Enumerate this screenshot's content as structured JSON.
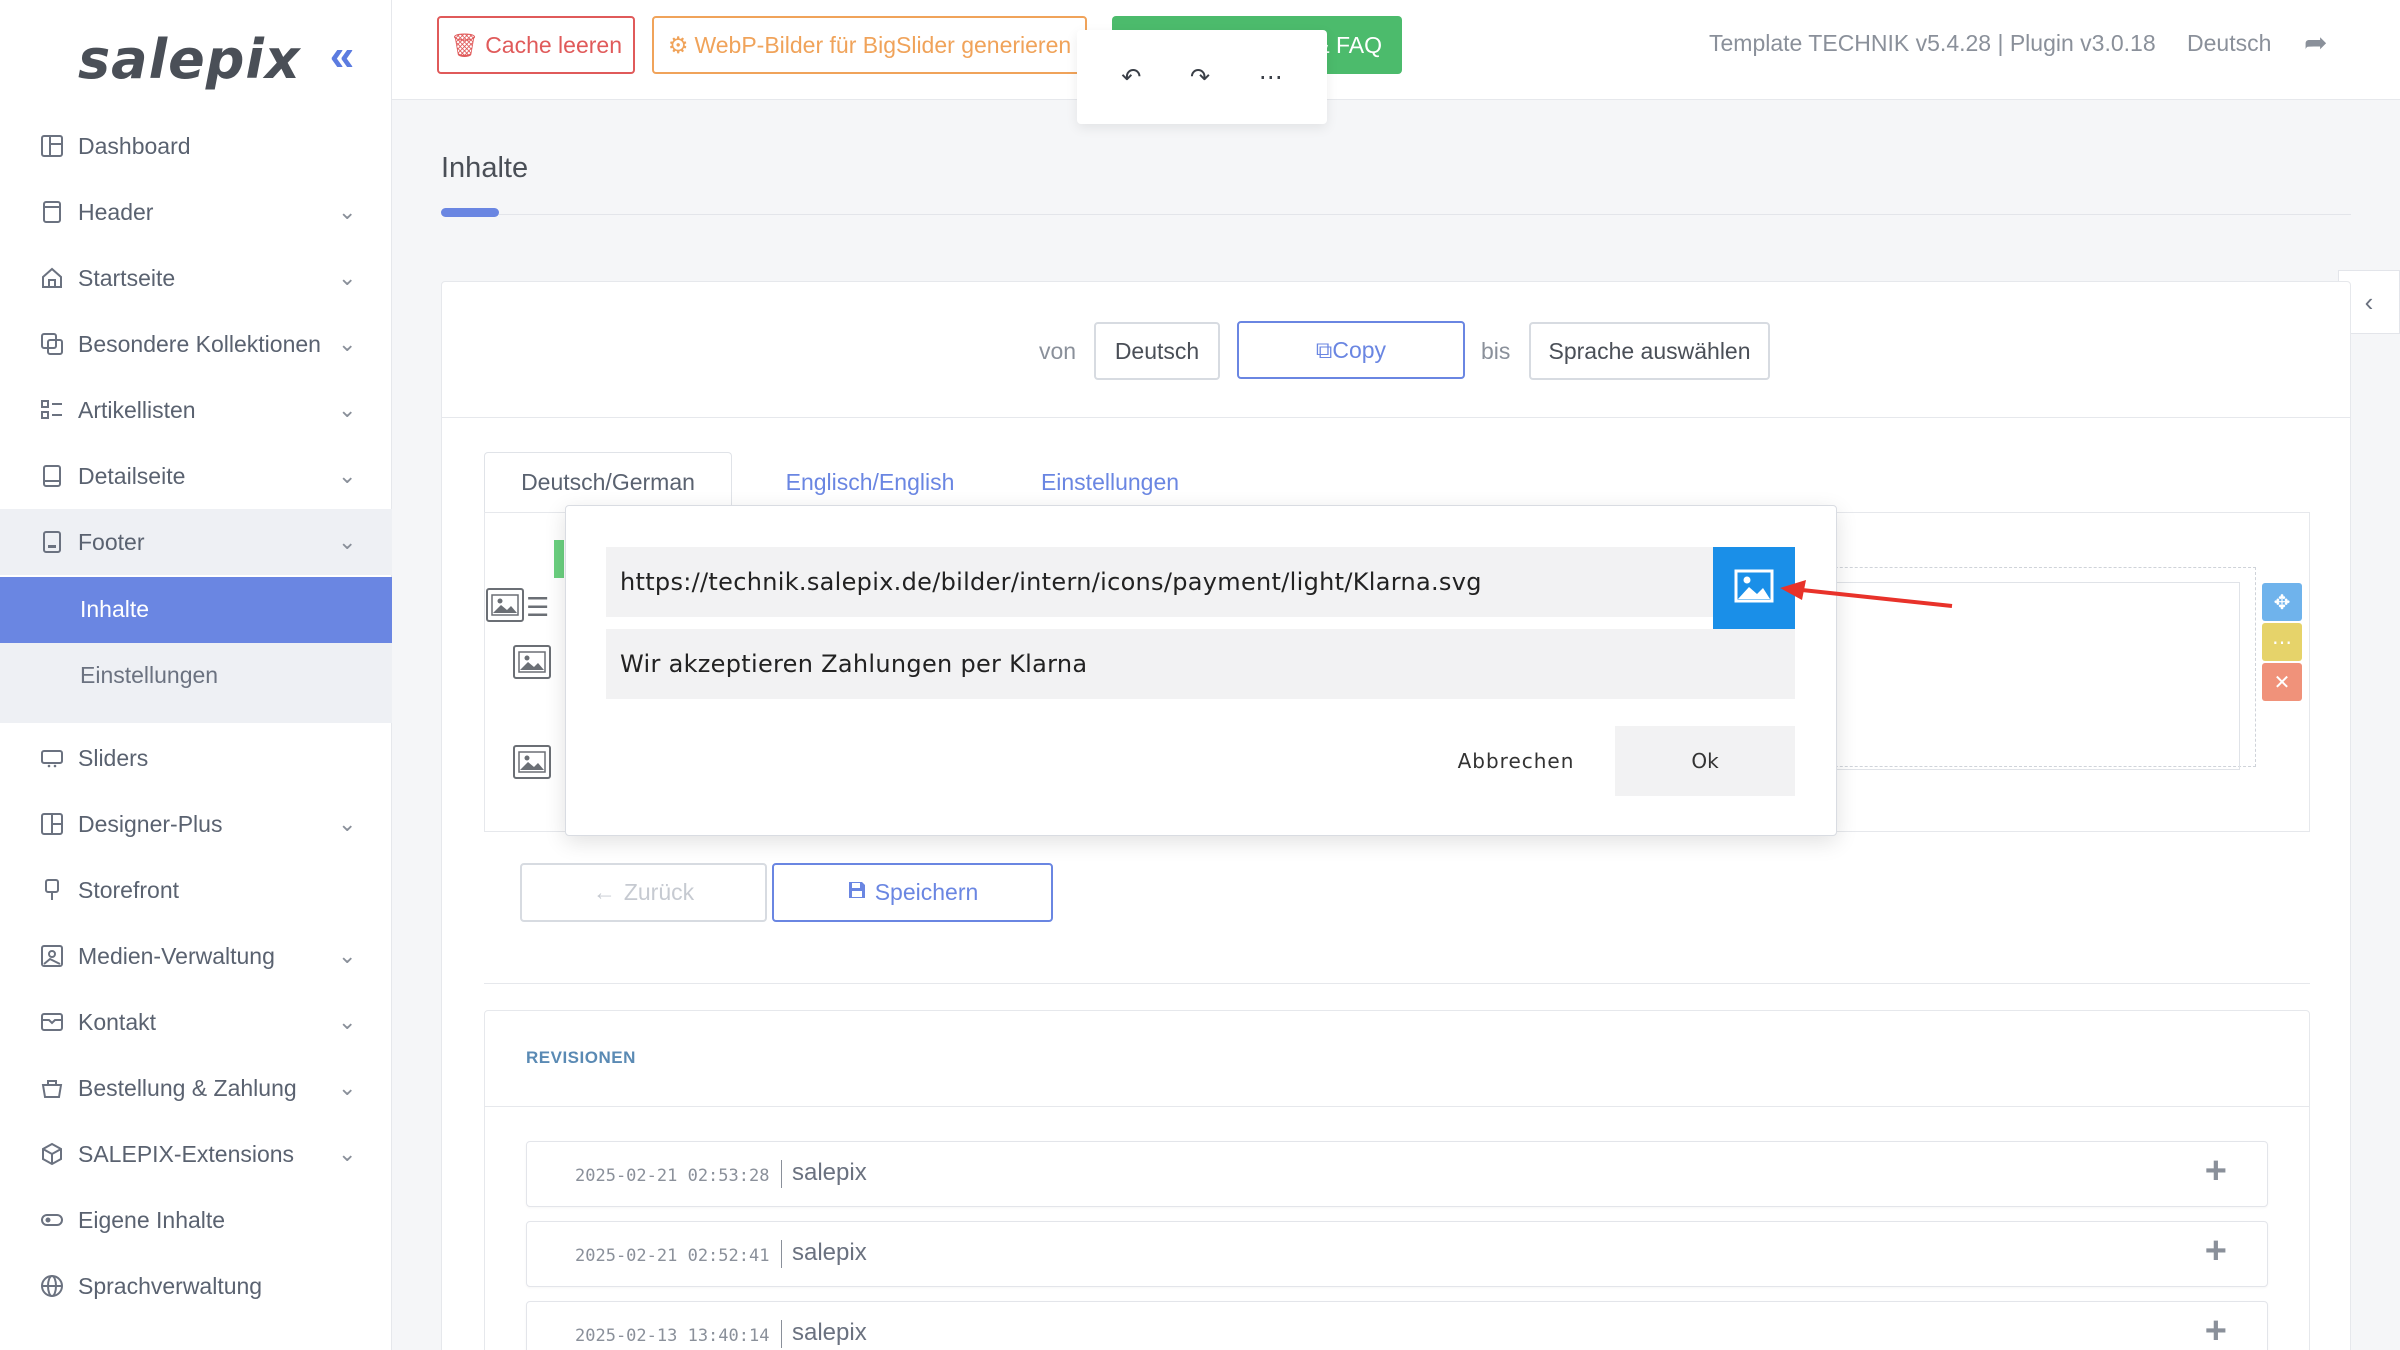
{
  "sidebar": {
    "logo": "salepix",
    "items": [
      {
        "label": "Dashboard",
        "icon": "dashboard-icon",
        "chevron": false
      },
      {
        "label": "Header",
        "icon": "header-icon",
        "chevron": true
      },
      {
        "label": "Startseite",
        "icon": "home-icon",
        "chevron": true
      },
      {
        "label": "Besondere Kollektionen",
        "icon": "collections-icon",
        "chevron": true
      },
      {
        "label": "Artikellisten",
        "icon": "list-icon",
        "chevron": true
      },
      {
        "label": "Detailseite",
        "icon": "detail-icon",
        "chevron": true
      },
      {
        "label": "Footer",
        "icon": "footer-icon",
        "chevron": true
      },
      {
        "label": "Sliders",
        "icon": "slider-icon",
        "chevron": false
      },
      {
        "label": "Designer-Plus",
        "icon": "designer-icon",
        "chevron": true
      },
      {
        "label": "Storefront",
        "icon": "storefront-icon",
        "chevron": false
      },
      {
        "label": "Medien-Verwaltung",
        "icon": "media-icon",
        "chevron": true
      },
      {
        "label": "Kontakt",
        "icon": "contact-icon",
        "chevron": true
      },
      {
        "label": "Bestellung & Zahlung",
        "icon": "basket-icon",
        "chevron": true
      },
      {
        "label": "SALEPIX-Extensions",
        "icon": "box-icon",
        "chevron": true
      },
      {
        "label": "Eigene Inhalte",
        "icon": "toggle-icon",
        "chevron": false
      },
      {
        "label": "Sprachverwaltung",
        "icon": "globe-icon",
        "chevron": false
      }
    ],
    "footer_sub": [
      {
        "label": "Inhalte",
        "active": true
      },
      {
        "label": "Einstellungen",
        "active": false
      }
    ]
  },
  "topbar": {
    "cache_label": "Cache leeren",
    "webp_label": "WebP-Bilder für BigSlider generieren",
    "green_label": "& FAQ",
    "version": "Template TECHNIK v5.4.28 | Plugin v3.0.18",
    "language": "Deutsch"
  },
  "page": {
    "title": "Inhalte"
  },
  "translate": {
    "from_label": "von",
    "from_value": "Deutsch",
    "copy_label": "Copy",
    "to_label": "bis",
    "to_value": "Sprache auswählen"
  },
  "tabs": [
    {
      "label": "Deutsch/German"
    },
    {
      "label": "Englisch/English"
    },
    {
      "label": "Einstellungen"
    }
  ],
  "actions": {
    "back_label": "Zurück",
    "save_label": "Speichern"
  },
  "revisions": {
    "title": "REVISIONEN",
    "rows": [
      {
        "date": "2025-02-21 02:53:28",
        "user": "salepix"
      },
      {
        "date": "2025-02-21 02:52:41",
        "user": "salepix"
      },
      {
        "date": "2025-02-13 13:40:14",
        "user": "salepix"
      }
    ]
  },
  "modal": {
    "url_value": "https://technik.salepix.de/bilder/intern/icons/payment/light/Klarna.svg",
    "alt_value": "Wir akzeptieren Zahlungen per Klarna",
    "cancel_label": "Abbrechen",
    "ok_label": "Ok"
  },
  "colors": {
    "accent": "#6a86e2",
    "danger": "#e05a5a",
    "warning": "#f0a35a",
    "success": "#4cbb6c",
    "image_picker": "#1a8fe8",
    "annotation_arrow": "#e8322a"
  }
}
